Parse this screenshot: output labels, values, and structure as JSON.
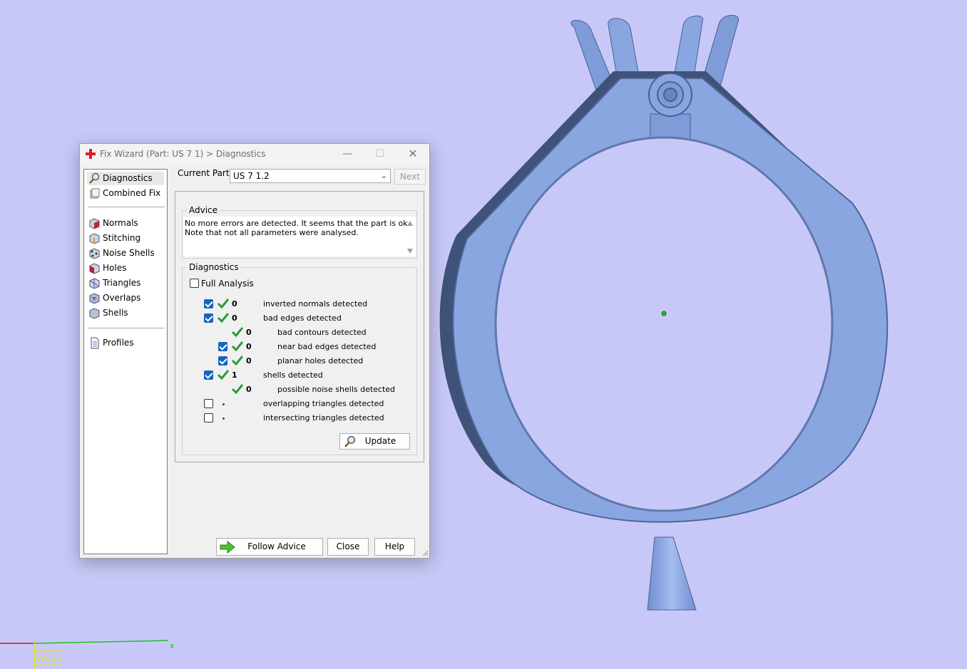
{
  "window": {
    "title": "Fix Wizard (Part: US 7 1) > Diagnostics",
    "controls": {
      "minimize": "—",
      "maximize": "☐",
      "close": "✕"
    }
  },
  "nav": {
    "items": [
      {
        "label": "Diagnostics",
        "icon": "magnifier-icon",
        "selected": true
      },
      {
        "label": "Combined Fix",
        "icon": "combined-fix-icon"
      },
      {
        "label": "Normals",
        "icon": "normals-cube-icon"
      },
      {
        "label": "Stitching",
        "icon": "stitching-cube-icon"
      },
      {
        "label": "Noise Shells",
        "icon": "noise-shells-icon"
      },
      {
        "label": "Holes",
        "icon": "holes-cube-icon"
      },
      {
        "label": "Triangles",
        "icon": "triangles-cube-icon"
      },
      {
        "label": "Overlaps",
        "icon": "overlaps-cube-icon"
      },
      {
        "label": "Shells",
        "icon": "shells-cube-icon"
      },
      {
        "label": "Profiles",
        "icon": "profiles-document-icon"
      }
    ]
  },
  "current_part": {
    "label": "Current Part:",
    "value": "US 7 1.2"
  },
  "next_label": "Next",
  "advice": {
    "title": "Advice",
    "line1": "No more errors are detected. It seems that the part is ok.",
    "line2": "Note that not all parameters were analysed."
  },
  "diagnostics": {
    "title": "Diagnostics",
    "full_analysis_label": "Full Analysis",
    "rows": [
      {
        "checkbox": "checked",
        "value": "0",
        "label": "inverted normals detected"
      },
      {
        "checkbox": "checked",
        "value": "0",
        "label": "bad edges detected"
      },
      {
        "checkbox": "none",
        "value": "0",
        "label": "bad contours detected"
      },
      {
        "checkbox": "checked",
        "value": "0",
        "label": "near bad edges detected"
      },
      {
        "checkbox": "checked",
        "value": "0",
        "label": "planar holes detected"
      },
      {
        "checkbox": "checked",
        "value": "1",
        "label": "shells detected"
      },
      {
        "checkbox": "none",
        "value": "0",
        "label": "possible noise shells detected"
      },
      {
        "checkbox": "unchecked",
        "value": "",
        "label": "overlapping triangles detected"
      },
      {
        "checkbox": "unchecked",
        "value": "",
        "label": "intersecting triangles detected"
      }
    ],
    "update_label": "Update"
  },
  "footer": {
    "follow_advice": "Follow Advice",
    "close": "Close",
    "help": "Help"
  },
  "viewport": {
    "axis_x_label": "x",
    "wcs_label": "WCS",
    "background": "#c8c8f8",
    "model_color": "#8aa6e0"
  }
}
